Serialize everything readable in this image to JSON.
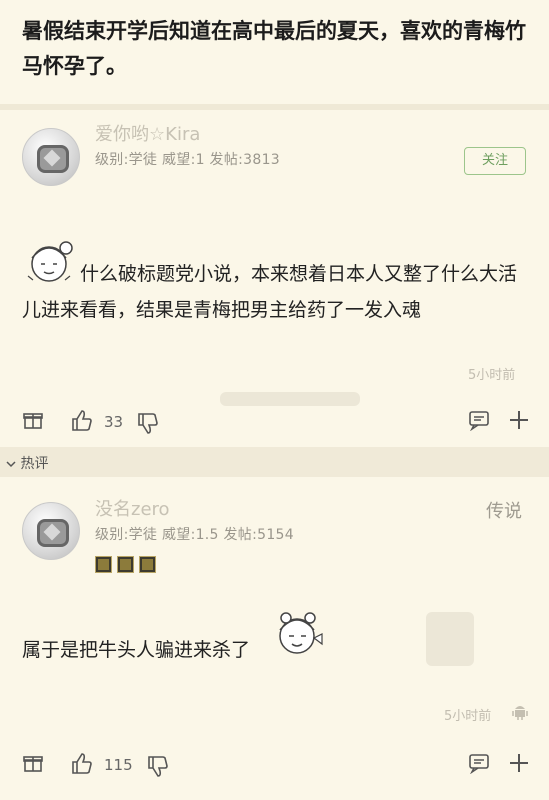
{
  "post": {
    "title": "暑假结束开学后知道在高中最后的夏天，喜欢的青梅竹马怀孕了。"
  },
  "comment1": {
    "username": "爱你哟☆Kira",
    "meta": "级别:学徒 威望:1 发帖:3813",
    "follow_label": "关注",
    "text": "什么破标题党小说，本来想着日本人又整了什么大活儿进来看看，结果是青梅把男主给药了一发入魂",
    "time": "5小时前",
    "like_count": "33"
  },
  "hot_section": {
    "label": "热评"
  },
  "comment2": {
    "username": "没名zero",
    "meta": "级别:学徒 威望:1.5 发帖:5154",
    "rank": "传说",
    "text": "属于是把牛头人骗进来杀了",
    "time": "5小时前",
    "like_count": "115"
  },
  "icons": [
    "avatar-icon",
    "gift-icon",
    "thumbs-up-icon",
    "thumbs-down-icon",
    "comment-icon",
    "plus-icon",
    "android-icon",
    "chevron-down-icon",
    "medal-icon"
  ],
  "colors": {
    "background": "#fbf7e8",
    "follow_green": "#6e9f5f",
    "meta_gray": "#9a968c"
  }
}
